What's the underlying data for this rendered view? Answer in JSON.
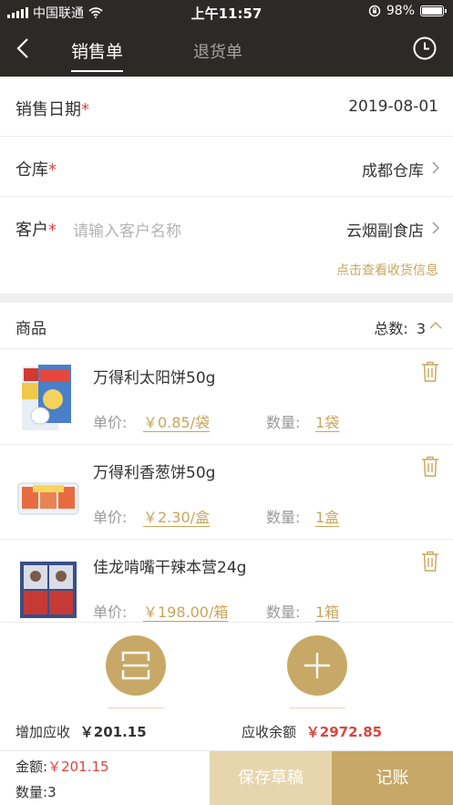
{
  "status_bar": {
    "carrier": "中国联通",
    "time": "上午11:57",
    "battery": "98%",
    "battery_level": 0.98
  },
  "nav": {
    "tabs": [
      {
        "label": "销售单",
        "active": true
      },
      {
        "label": "退货单",
        "active": false
      }
    ]
  },
  "form": {
    "sale_date": {
      "label": "销售日期",
      "required_mark": "*",
      "value": "2019-08-01"
    },
    "warehouse": {
      "label": "仓库",
      "required_mark": "*",
      "value": "成都仓库"
    },
    "customer": {
      "label": "客户",
      "required_mark": "*",
      "placeholder": "请输入客户名称",
      "value": "云烟副食店"
    },
    "receipt_link": "点击查看收货信息"
  },
  "goods": {
    "title": "商品",
    "total_label": "总数:",
    "total_value": "3",
    "price_label": "单价:",
    "qty_label": "数量:",
    "items": [
      {
        "name": "万得利太阳饼50g",
        "price": "￥0.85/袋",
        "qty": "1袋"
      },
      {
        "name": "万得利香葱饼50g",
        "price": "￥2.30/盒",
        "qty": "1盒"
      },
      {
        "name": "佳龙啃嘴干辣本营24g",
        "price": "￥198.00/箱",
        "qty": "1箱"
      }
    ]
  },
  "summary": {
    "receivable_add_label": "增加应收",
    "receivable_add_value": "￥201.15",
    "receivable_balance_label": "应收余额",
    "receivable_balance_value": "￥2972.85"
  },
  "footer": {
    "amount_label": "金额:",
    "amount_value": "￥201.15",
    "count_label": "数量:",
    "count_value": "3",
    "save_draft": "保存草稿",
    "post": "记账"
  },
  "colors": {
    "nav_bg": "#2c2a27",
    "accent_gold": "#c7a866",
    "light_gold": "#e7d5ad",
    "required_red": "#d9463e"
  }
}
